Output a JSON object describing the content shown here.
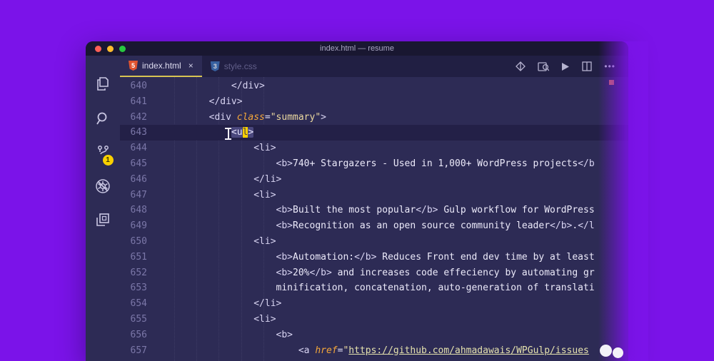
{
  "window": {
    "title": "index.html — resume"
  },
  "tabs": [
    {
      "label": "index.html",
      "icon_text": "5",
      "active": true
    },
    {
      "label": "style.css",
      "icon_text": "3",
      "active": false
    }
  ],
  "icons": {
    "close_tab": "×",
    "more_actions": "•••"
  },
  "activity_bar": {
    "badge": "1"
  },
  "editor": {
    "current_line": 643,
    "lines": [
      {
        "num": 640,
        "segments": [
          {
            "t": "tag",
            "s": "            </div>"
          }
        ]
      },
      {
        "num": 641,
        "segments": [
          {
            "t": "tag",
            "s": "        </div>"
          }
        ]
      },
      {
        "num": 642,
        "segments": [
          {
            "t": "tag",
            "s": "        <div "
          },
          {
            "t": "attr",
            "s": "class"
          },
          {
            "t": "punct",
            "s": "="
          },
          {
            "t": "str",
            "s": "\"summary\""
          },
          {
            "t": "tag",
            "s": ">"
          }
        ]
      },
      {
        "num": 643,
        "segments": [
          {
            "t": "plain",
            "s": "            "
          },
          {
            "t": "sel",
            "s": "<u"
          },
          {
            "t": "caret",
            "s": "l"
          },
          {
            "t": "sel",
            "s": ">"
          }
        ]
      },
      {
        "num": 644,
        "segments": [
          {
            "t": "tag",
            "s": "                <li>"
          }
        ]
      },
      {
        "num": 645,
        "segments": [
          {
            "t": "tag",
            "s": "                    <b>"
          },
          {
            "t": "text",
            "s": "740+ Stargazers - Used in 1,000+ WordPress projects"
          },
          {
            "t": "tag",
            "s": "</b"
          }
        ]
      },
      {
        "num": 646,
        "segments": [
          {
            "t": "tag",
            "s": "                </li>"
          }
        ]
      },
      {
        "num": 647,
        "segments": [
          {
            "t": "tag",
            "s": "                <li>"
          }
        ]
      },
      {
        "num": 648,
        "segments": [
          {
            "t": "tag",
            "s": "                    <b>"
          },
          {
            "t": "text",
            "s": "Built the most popular"
          },
          {
            "t": "tag",
            "s": "</b>"
          },
          {
            "t": "text",
            "s": " Gulp workflow for WordPress"
          }
        ]
      },
      {
        "num": 649,
        "segments": [
          {
            "t": "tag",
            "s": "                    <b>"
          },
          {
            "t": "text",
            "s": "Recognition as an open source community leader"
          },
          {
            "t": "tag",
            "s": "</b>"
          },
          {
            "t": "text",
            "s": "."
          },
          {
            "t": "tag",
            "s": "</l"
          }
        ]
      },
      {
        "num": 650,
        "segments": [
          {
            "t": "tag",
            "s": "                <li>"
          }
        ]
      },
      {
        "num": 651,
        "segments": [
          {
            "t": "tag",
            "s": "                    <b>"
          },
          {
            "t": "text",
            "s": "Automation:"
          },
          {
            "t": "tag",
            "s": "</b>"
          },
          {
            "t": "text",
            "s": " Reduces Front end dev time by at least"
          }
        ]
      },
      {
        "num": 652,
        "segments": [
          {
            "t": "tag",
            "s": "                    <b>"
          },
          {
            "t": "text",
            "s": "20%"
          },
          {
            "t": "tag",
            "s": "</b>"
          },
          {
            "t": "text",
            "s": " and increases code effeciency by automating gr"
          }
        ]
      },
      {
        "num": 653,
        "segments": [
          {
            "t": "text",
            "s": "                    minification, concatenation, auto-generation of translati"
          }
        ]
      },
      {
        "num": 654,
        "segments": [
          {
            "t": "tag",
            "s": "                </li>"
          }
        ]
      },
      {
        "num": 655,
        "segments": [
          {
            "t": "tag",
            "s": "                <li>"
          }
        ]
      },
      {
        "num": 656,
        "segments": [
          {
            "t": "tag",
            "s": "                    <b>"
          }
        ]
      },
      {
        "num": 657,
        "segments": [
          {
            "t": "tag",
            "s": "                        <a "
          },
          {
            "t": "attr",
            "s": "href"
          },
          {
            "t": "punct",
            "s": "="
          },
          {
            "t": "str",
            "s": "\""
          },
          {
            "t": "link",
            "s": "https://github.com/ahmadawais/WPGulp/issues"
          }
        ]
      }
    ]
  }
}
